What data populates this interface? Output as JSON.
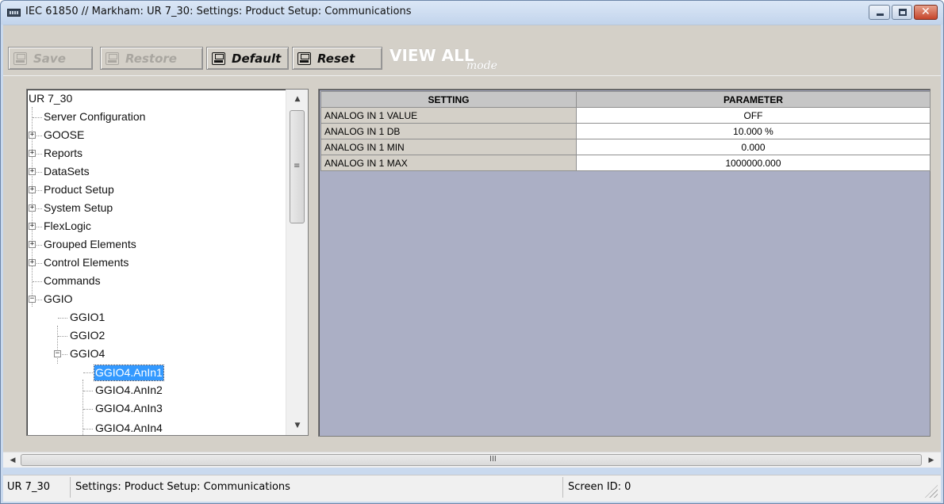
{
  "window": {
    "title": "IEC 61850 // Markham: UR 7_30: Settings: Product Setup: Communications",
    "buttons": {
      "minimize_icon": "minimize-icon",
      "maximize_icon": "maximize-icon",
      "close_glyph": "✕"
    }
  },
  "toolbar": {
    "save_label": "Save",
    "restore_label": "Restore",
    "default_label": "Default",
    "reset_label": "Reset",
    "view_all_big": "VIEW ALL",
    "view_all_small": "mode",
    "save_enabled": false,
    "restore_enabled": false
  },
  "tree": {
    "root": "UR 7_30",
    "items": [
      {
        "label": "Server Configuration",
        "expander": ""
      },
      {
        "label": "GOOSE",
        "expander": "+"
      },
      {
        "label": "Reports",
        "expander": "+"
      },
      {
        "label": "DataSets",
        "expander": "+"
      },
      {
        "label": "Product Setup",
        "expander": "+"
      },
      {
        "label": "System Setup",
        "expander": "+"
      },
      {
        "label": "FlexLogic",
        "expander": "+"
      },
      {
        "label": "Grouped Elements",
        "expander": "+"
      },
      {
        "label": "Control Elements",
        "expander": "+"
      },
      {
        "label": "Commands",
        "expander": ""
      },
      {
        "label": "GGIO",
        "expander": "−"
      },
      {
        "label": "GGIO1",
        "expander": ""
      },
      {
        "label": "GGIO2",
        "expander": ""
      },
      {
        "label": "GGIO4",
        "expander": "−"
      },
      {
        "label": "GGIO4.AnIn1",
        "expander": "",
        "selected": true
      },
      {
        "label": "GGIO4.AnIn2",
        "expander": ""
      },
      {
        "label": "GGIO4.AnIn3",
        "expander": ""
      },
      {
        "label": "GGIO4.AnIn4",
        "expander": ""
      }
    ]
  },
  "table": {
    "headers": [
      "SETTING",
      "PARAMETER"
    ],
    "rows": [
      [
        "ANALOG IN 1 VALUE",
        "OFF"
      ],
      [
        "ANALOG IN 1 DB",
        "10.000 %"
      ],
      [
        "ANALOG IN 1 MIN",
        "0.000"
      ],
      [
        "ANALOG IN 1 MAX",
        "1000000.000"
      ]
    ]
  },
  "scroll": {
    "grip": "III",
    "vgrip": "≡",
    "left_arrow": "◀",
    "right_arrow": "▶",
    "up_arrow": "▲",
    "down_arrow": "▼"
  },
  "status": {
    "device": "UR 7_30",
    "path": "Settings: Product Setup: Communications",
    "screen_id": "Screen ID: 0"
  },
  "colors": {
    "grid_background": "#abafc5",
    "selection": "#3399ff",
    "dialog_face": "#d4d0c8"
  }
}
